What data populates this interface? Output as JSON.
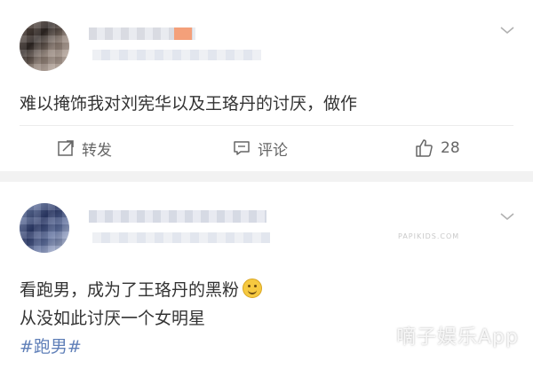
{
  "post1": {
    "text": "难以掩饰我对刘宪华以及王珞丹的讨厌，做作",
    "actions": {
      "repost_label": "转发",
      "comment_label": "评论",
      "like_count": "28"
    }
  },
  "post2": {
    "line1": "看跑男，成为了王珞丹的黑粉",
    "line2": "从没如此讨厌一个女明星",
    "hashtag": "#跑男#"
  },
  "watermark": {
    "main": "嘀子娱乐App",
    "small": "PAPIKIDS.COM"
  },
  "colors": {
    "link": "#5f7fb8",
    "separator": "#f2f2f2",
    "text": "#333333",
    "muted": "#666666"
  }
}
